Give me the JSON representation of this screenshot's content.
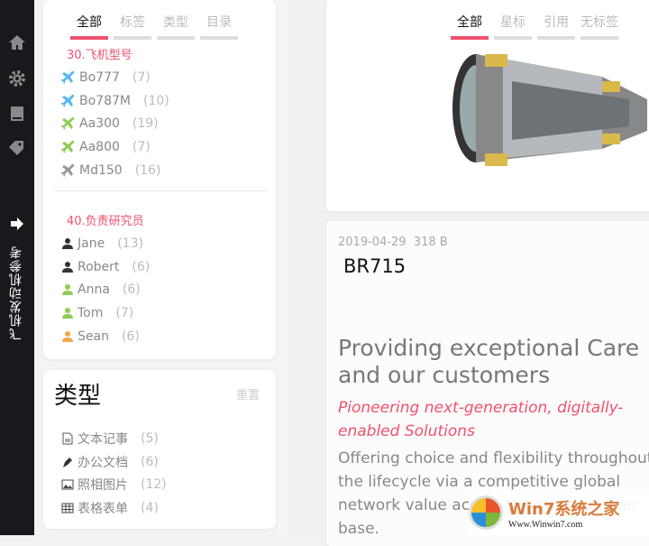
{
  "sidebar": {
    "vertical_title": "飞机发动机参考"
  },
  "left_tabs": [
    "全部",
    "标签",
    "类型",
    "目录"
  ],
  "group1": {
    "title": "30.飞机型号",
    "items": [
      {
        "label": "Bo777",
        "count": "(7)",
        "color": "#55b8f0"
      },
      {
        "label": "Bo787M",
        "count": "(10)",
        "color": "#55b8f0"
      },
      {
        "label": "Aa300",
        "count": "(19)",
        "color": "#8fcc55"
      },
      {
        "label": "Aa800",
        "count": "(7)",
        "color": "#8fcc55"
      },
      {
        "label": "Md150",
        "count": "(16)",
        "color": "#999999"
      }
    ]
  },
  "group2": {
    "title": "40.负责研究员",
    "items": [
      {
        "label": "Jane",
        "count": "(13)",
        "color": "#333333"
      },
      {
        "label": "Robert",
        "count": "(6)",
        "color": "#333333"
      },
      {
        "label": "Anna",
        "count": "(6)",
        "color": "#8fcc55"
      },
      {
        "label": "Tom",
        "count": "(7)",
        "color": "#8fcc55"
      },
      {
        "label": "Sean",
        "count": "(6)",
        "color": "#f5a64a"
      }
    ]
  },
  "types": {
    "title": "类型",
    "reset": "重置",
    "items": [
      {
        "label": "文本记事",
        "count": "(5)",
        "icon": "document-icon"
      },
      {
        "label": "办公文档",
        "count": "(6)",
        "icon": "pen-icon"
      },
      {
        "label": "照相图片",
        "count": "(12)",
        "icon": "image-icon"
      },
      {
        "label": "表格表单",
        "count": "(4)",
        "icon": "table-icon"
      }
    ]
  },
  "right_tabs": [
    "全部",
    "星标",
    "引用",
    "无标签"
  ],
  "note": {
    "date": "2019-04-29",
    "size": "318 B",
    "title": "BR715",
    "heading": "Providing exceptional Care and our customers",
    "subheading": "Pioneering next-generation, digitally-enabled Solutions",
    "body": "Offering choice and flexibility throughout the lifecycle via a competitive global network value across the our customer base."
  },
  "watermark": {
    "brand": "Win7系统之家",
    "url": "Www.Winwin7.com"
  }
}
